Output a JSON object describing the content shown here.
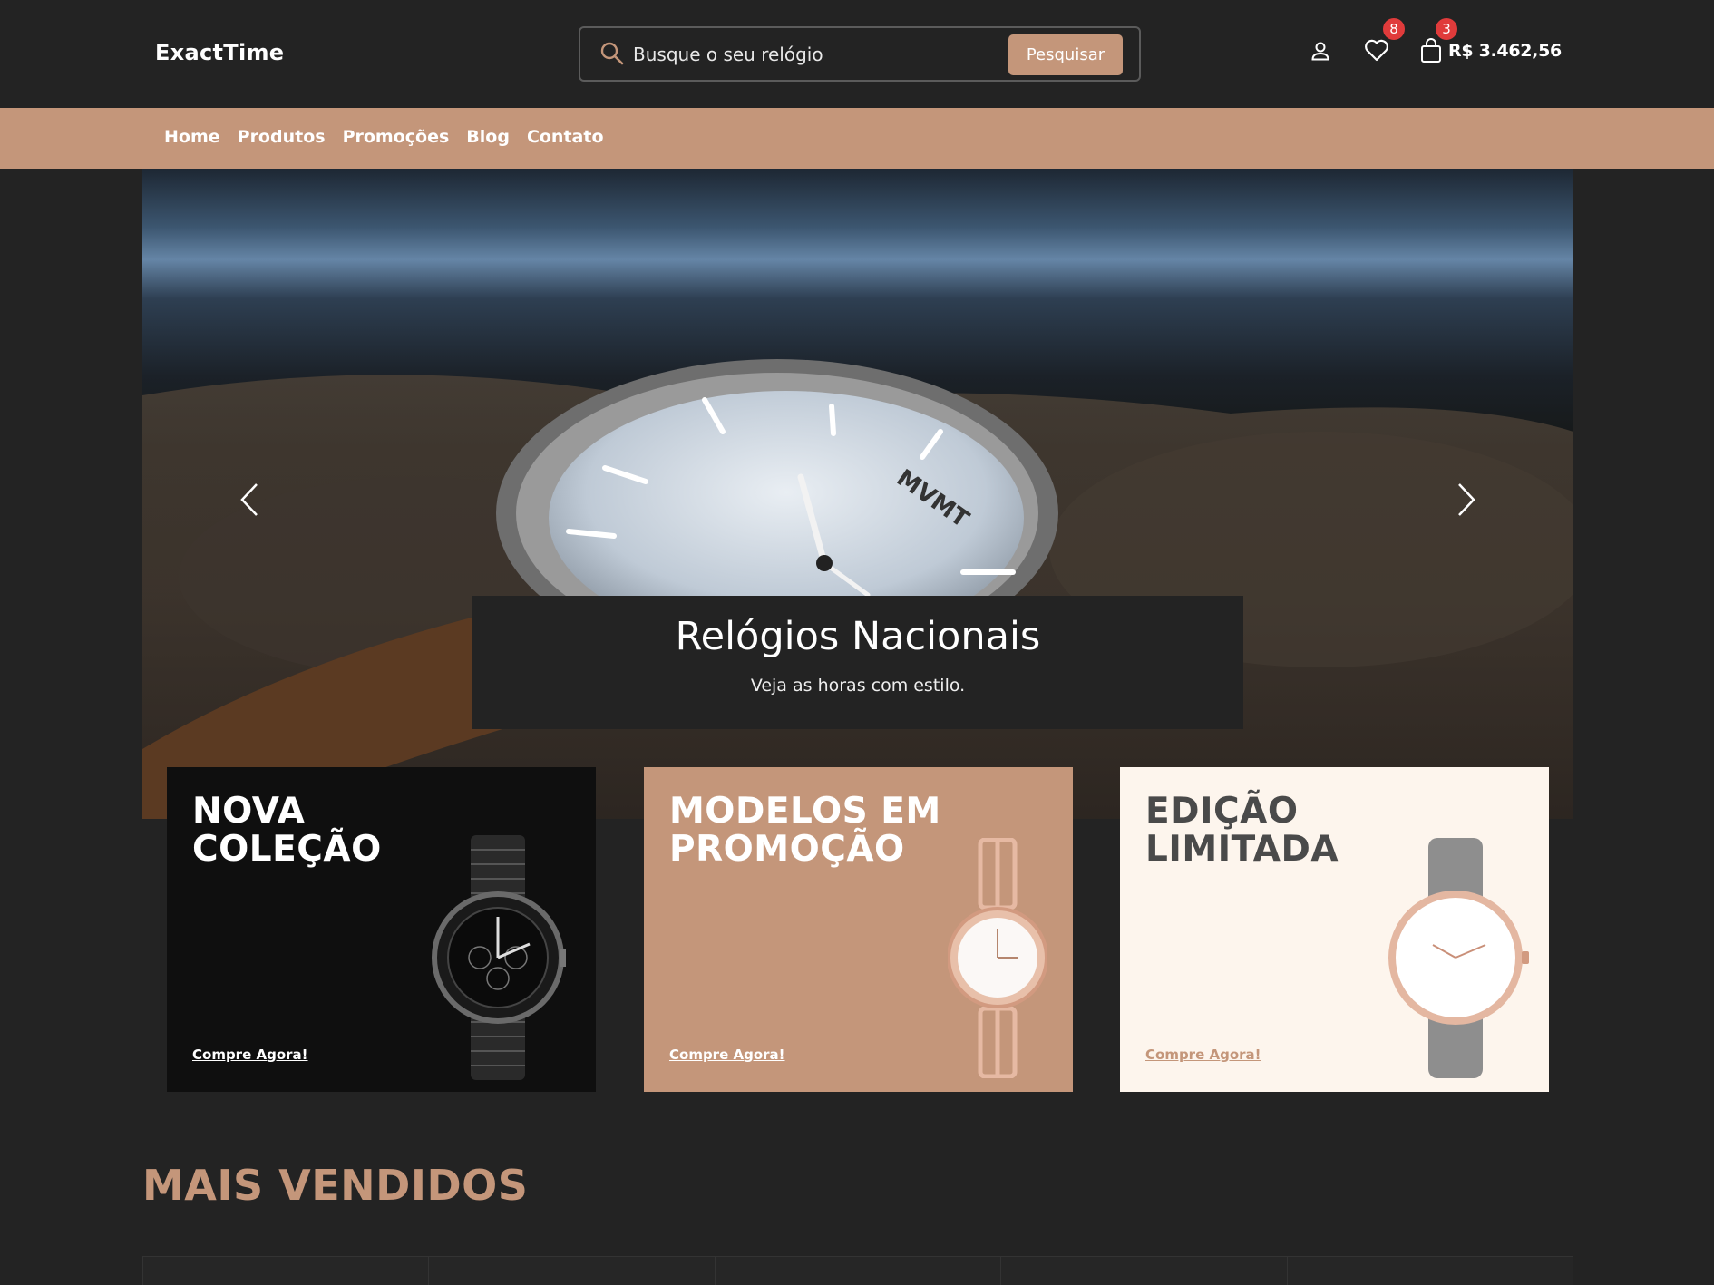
{
  "header": {
    "logo": "ExactTime",
    "search": {
      "placeholder": "Busque o seu relógio",
      "button_label": "Pesquisar"
    },
    "icons": [
      "user-icon",
      "heart-icon",
      "shopping-bag-icon",
      "search-icon"
    ],
    "wishlist_count": "8",
    "cart_count": "3",
    "cart_total": "R$ 3.462,56"
  },
  "nav": {
    "items": [
      {
        "label": "Home"
      },
      {
        "label": "Produtos"
      },
      {
        "label": "Promoções"
      },
      {
        "label": "Blog"
      },
      {
        "label": "Contato"
      }
    ]
  },
  "hero": {
    "title": "Relógios Nacionais",
    "subtitle": "Veja as horas com estilo.",
    "watch_brand": "MVMT"
  },
  "promos": [
    {
      "title": "Nova Coleção",
      "link": "Compre Agora!"
    },
    {
      "title": "Modelos em Promoção",
      "link": "Compre Agora!"
    },
    {
      "title": "Edição Limitada",
      "link": "Compre Agora!"
    }
  ],
  "best_sellers": {
    "title": "MAIS VENDIDOS"
  },
  "colors": {
    "background": "#232323",
    "accent": "#c4967a",
    "badge": "#e03b3b",
    "cream": "#fdf5ed"
  }
}
